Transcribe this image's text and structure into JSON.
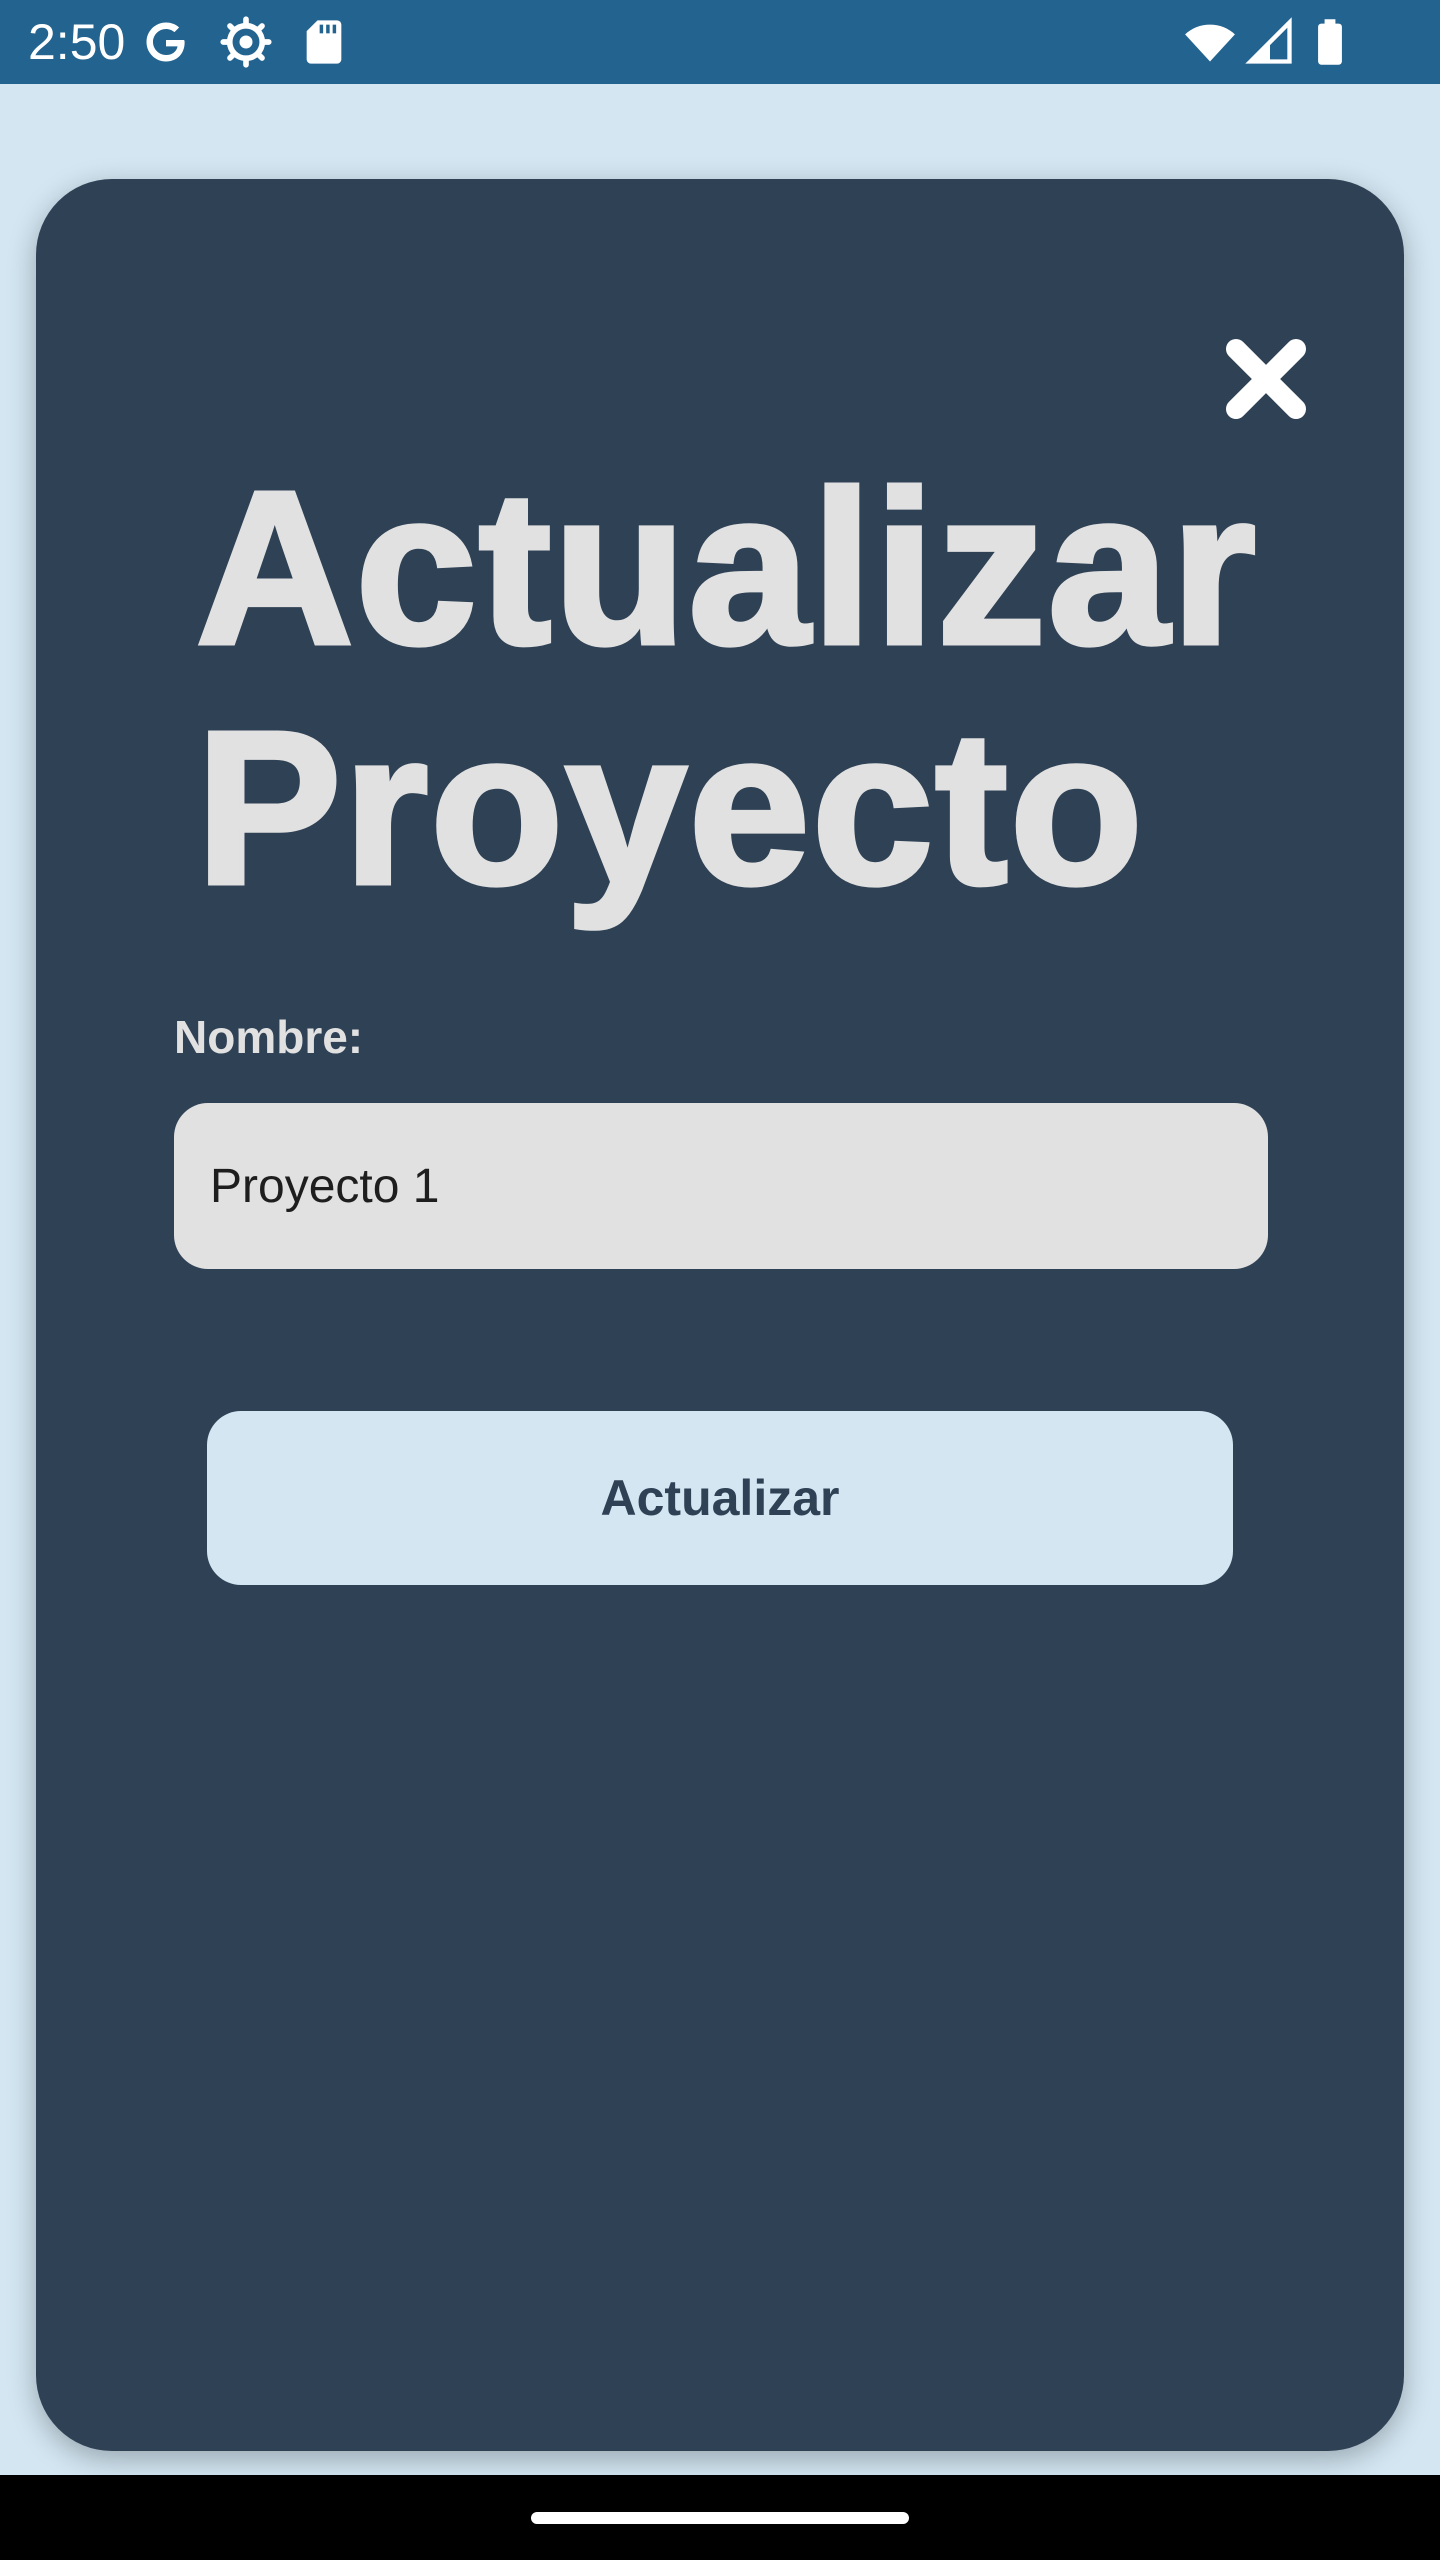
{
  "status_bar": {
    "time": "2:50",
    "icons": [
      "google-icon",
      "settings-gear-icon",
      "sd-card-icon",
      "wifi-icon",
      "cell-signal-icon",
      "battery-icon"
    ]
  },
  "dialog": {
    "title_line1": "Actualizar",
    "title_line2": "Proyecto",
    "close_icon": "close-icon",
    "name_label": "Nombre:",
    "name_value": "Proyecto 1",
    "submit_label": "Actualizar"
  },
  "colors": {
    "status_bar": "#226390",
    "background": "#d3e6f2",
    "dialog": "#2f4155",
    "input": "#e1e1e1",
    "button": "#d3e6f2",
    "text_light": "#e1e1e1"
  }
}
